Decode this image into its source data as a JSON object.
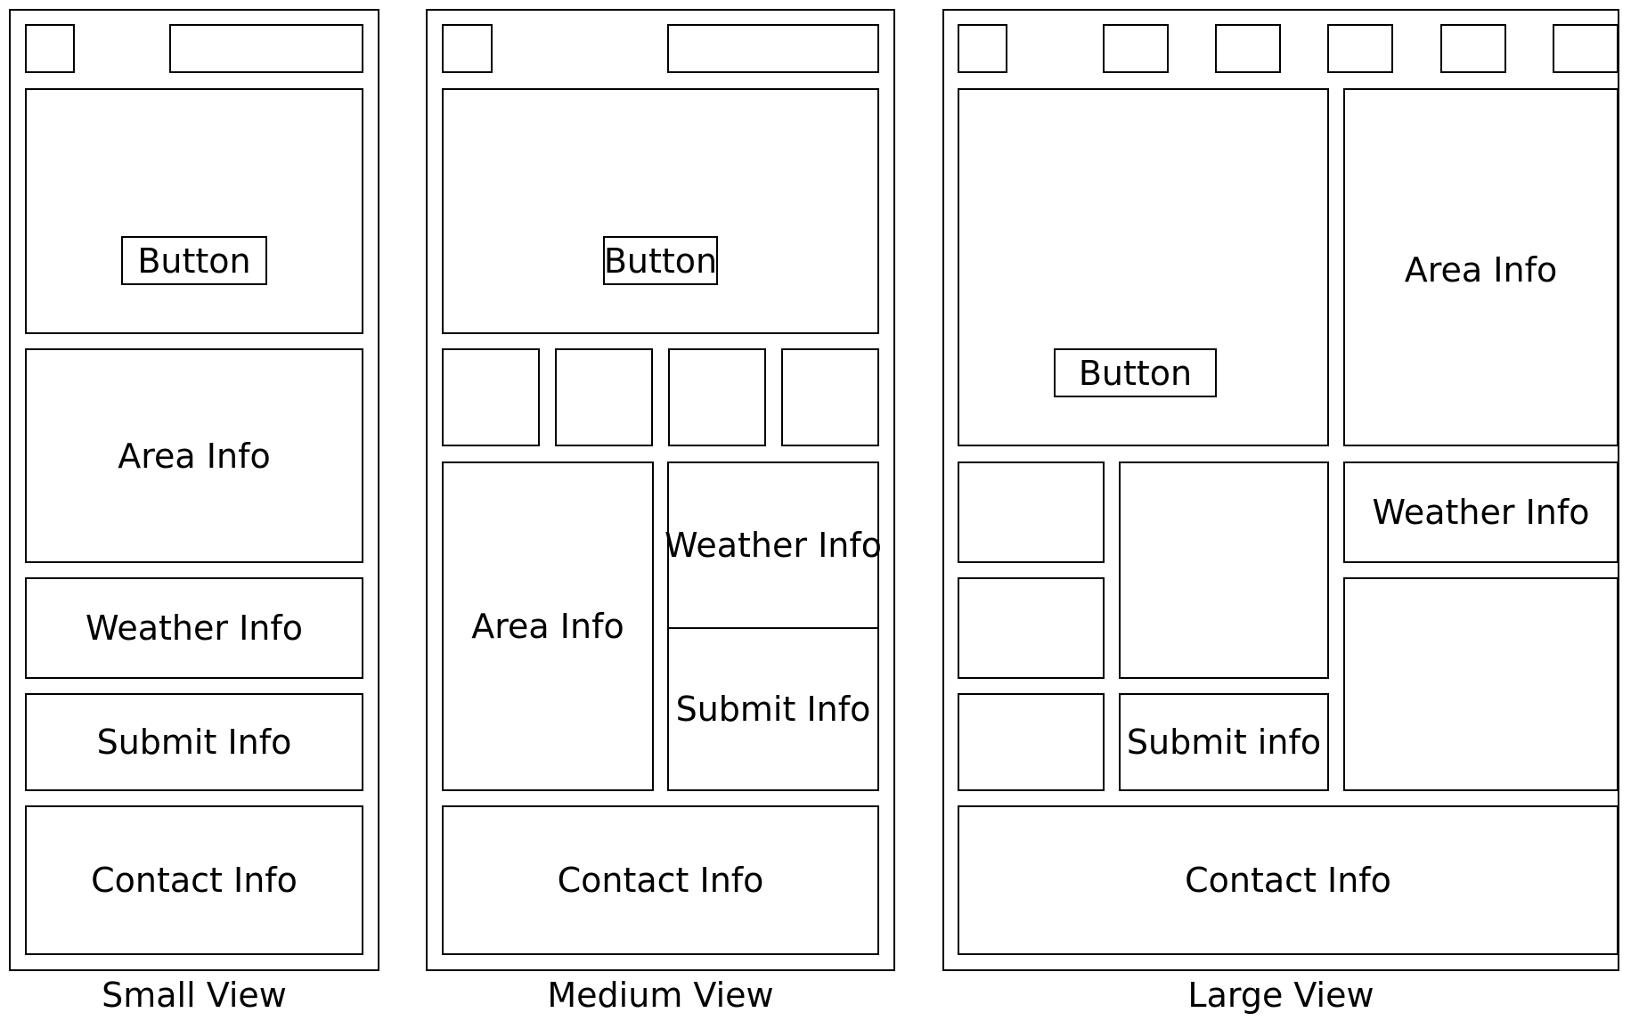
{
  "views": {
    "small": {
      "caption": "Small View",
      "button": "Button",
      "area_info": "Area Info",
      "weather_info": "Weather Info",
      "submit_info": "Submit Info",
      "contact_info": "Contact Info"
    },
    "medium": {
      "caption": "Medium View",
      "button": "Button",
      "area_info": "Area Info",
      "weather_info": "Weather Info",
      "submit_info": "Submit Info",
      "contact_info": "Contact Info"
    },
    "large": {
      "caption": "Large View",
      "button": "Button",
      "area_info": "Area Info",
      "weather_info": "Weather Info",
      "submit_info": "Submit info",
      "contact_info": "Contact Info"
    }
  }
}
